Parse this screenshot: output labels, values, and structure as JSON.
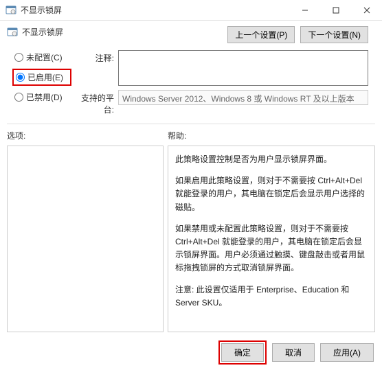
{
  "window": {
    "title": "不显示锁屏",
    "policy_name": "不显示锁屏"
  },
  "nav": {
    "prev": "上一个设置(P)",
    "next": "下一个设置(N)"
  },
  "radios": {
    "not_configured": "未配置(C)",
    "enabled": "已启用(E)",
    "disabled": "已禁用(D)"
  },
  "fields": {
    "comment_label": "注释:",
    "comment_value": "",
    "platform_label": "支持的平台:",
    "platform_value": "Windows Server 2012、Windows 8 或 Windows RT 及以上版本"
  },
  "sections": {
    "options": "选项:",
    "help": "帮助:"
  },
  "help": {
    "p1": "此策略设置控制是否为用户显示锁屏界面。",
    "p2": "如果启用此策略设置，则对于不需要按 Ctrl+Alt+Del 就能登录的用户，其电脑在锁定后会显示用户选择的磁贴。",
    "p3": "如果禁用或未配置此策略设置，则对于不需要按 Ctrl+Alt+Del 就能登录的用户，其电脑在锁定后会显示锁屏界面。用户必须通过触摸、键盘敲击或者用鼠标拖拽锁屏的方式取消锁屏界面。",
    "p4": "注意: 此设置仅适用于 Enterprise、Education 和 Server SKU。"
  },
  "buttons": {
    "ok": "确定",
    "cancel": "取消",
    "apply": "应用(A)"
  }
}
